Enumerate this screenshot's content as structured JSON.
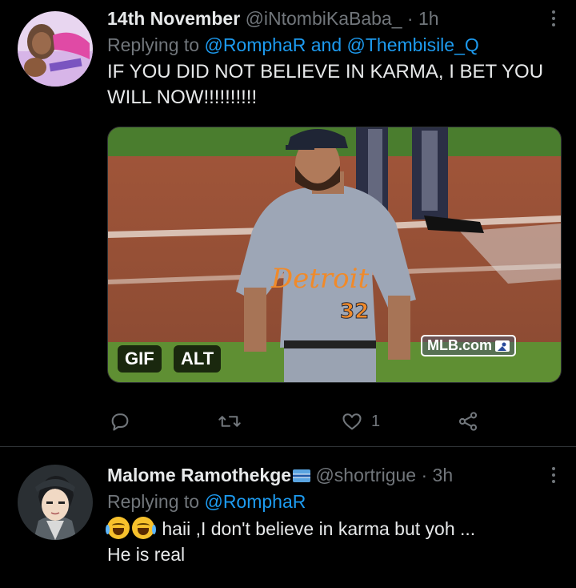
{
  "tweet1": {
    "name": "14th November",
    "handle": "@iNtombiKaBaba_",
    "dot": "·",
    "time": "1h",
    "reply_prefix": "Replying to",
    "reply_user1": "@RomphaR",
    "reply_and": "and",
    "reply_user2": "@Thembisile_Q",
    "text": "IF YOU DID NOT BELIEVE IN KARMA, I BET YOU WILL NOW!!!!!!!!!!",
    "media": {
      "gif_label": "GIF",
      "alt_label": "ALT",
      "watermark": "MLB.com",
      "jersey_text": "Detroit",
      "jersey_number": "32"
    },
    "likes": "1"
  },
  "tweet2": {
    "name": "Malome Ramothekge",
    "handle": "@shortrigue",
    "dot": "·",
    "time": "3h",
    "reply_prefix": "Replying to",
    "reply_user1": "@RomphaR",
    "text_line1": "haii ,I don't believe in karma but yoh ...",
    "text_line2": "He is real"
  },
  "colors": {
    "background": "#000000",
    "text": "#e7e9ea",
    "muted": "#71767b",
    "link": "#1d9bf0",
    "divider": "#2f3336"
  },
  "icons": [
    "more-icon",
    "reply-icon",
    "retweet-icon",
    "like-icon",
    "share-icon",
    "tears-of-joy-emoji",
    "flag-emoji"
  ]
}
